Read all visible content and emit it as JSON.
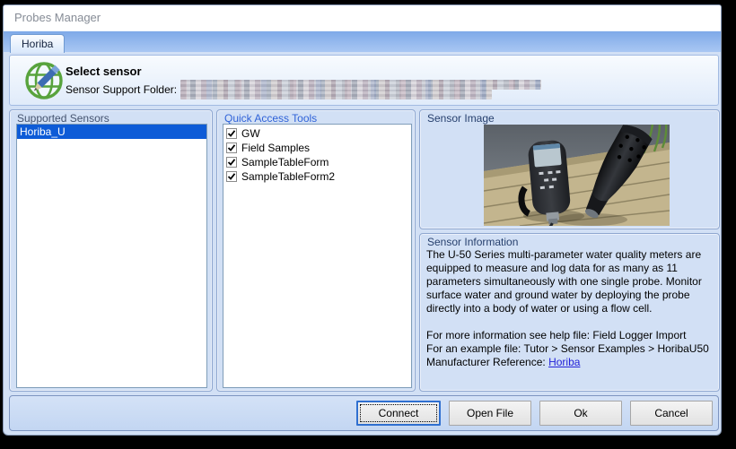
{
  "window": {
    "title": "Probes Manager"
  },
  "tabs": {
    "horiba": {
      "label": "Horiba",
      "active": true
    }
  },
  "header": {
    "icon": "globe-pencil-icon",
    "title": "Select sensor",
    "folder_label": "Sensor Support Folder:",
    "folder_value_redacted": true
  },
  "supported_sensors": {
    "title": "Supported Sensors",
    "items": [
      {
        "label": "Horiba_U",
        "selected": true
      }
    ]
  },
  "quick_access_tools": {
    "title": "Quick Access Tools",
    "items": [
      {
        "label": "GW",
        "checked": true
      },
      {
        "label": "Field Samples",
        "checked": true
      },
      {
        "label": "SampleTableForm",
        "checked": true
      },
      {
        "label": "SampleTableForm2",
        "checked": true
      }
    ]
  },
  "sensor_image": {
    "title": "Sensor Image",
    "photo_alt": "Horiba U-50 handheld meter and black probe on a wooden dock"
  },
  "sensor_information": {
    "title": "Sensor Information",
    "description": "The U-50 Series multi-parameter water quality meters are equipped to measure and log data for as many as 11 parameters simultaneously with one single probe. Monitor surface water and ground water by deploying the probe directly into a body of water or using a flow cell.",
    "help_line": "For more information see help file: Field Logger Import",
    "example_line": "For an example file: Tutor > Sensor Examples > HoribaU50",
    "manufacturer_label": "Manufacturer Reference: ",
    "manufacturer_link": "Horiba"
  },
  "footer": {
    "buttons": [
      {
        "label": "Connect",
        "focused": true
      },
      {
        "label": "Open File"
      },
      {
        "label": "Ok"
      },
      {
        "label": "Cancel"
      }
    ]
  },
  "colors": {
    "selection_blue": "#0d5bd7",
    "link_blue": "#2323d9",
    "tab_strip_blue": "#8db4ef",
    "group_label_navy": "#27406e",
    "group_label_blue": "#2f62d8",
    "window_background": "#d2e0f5",
    "focus_button_border": "#2f6fd0"
  }
}
